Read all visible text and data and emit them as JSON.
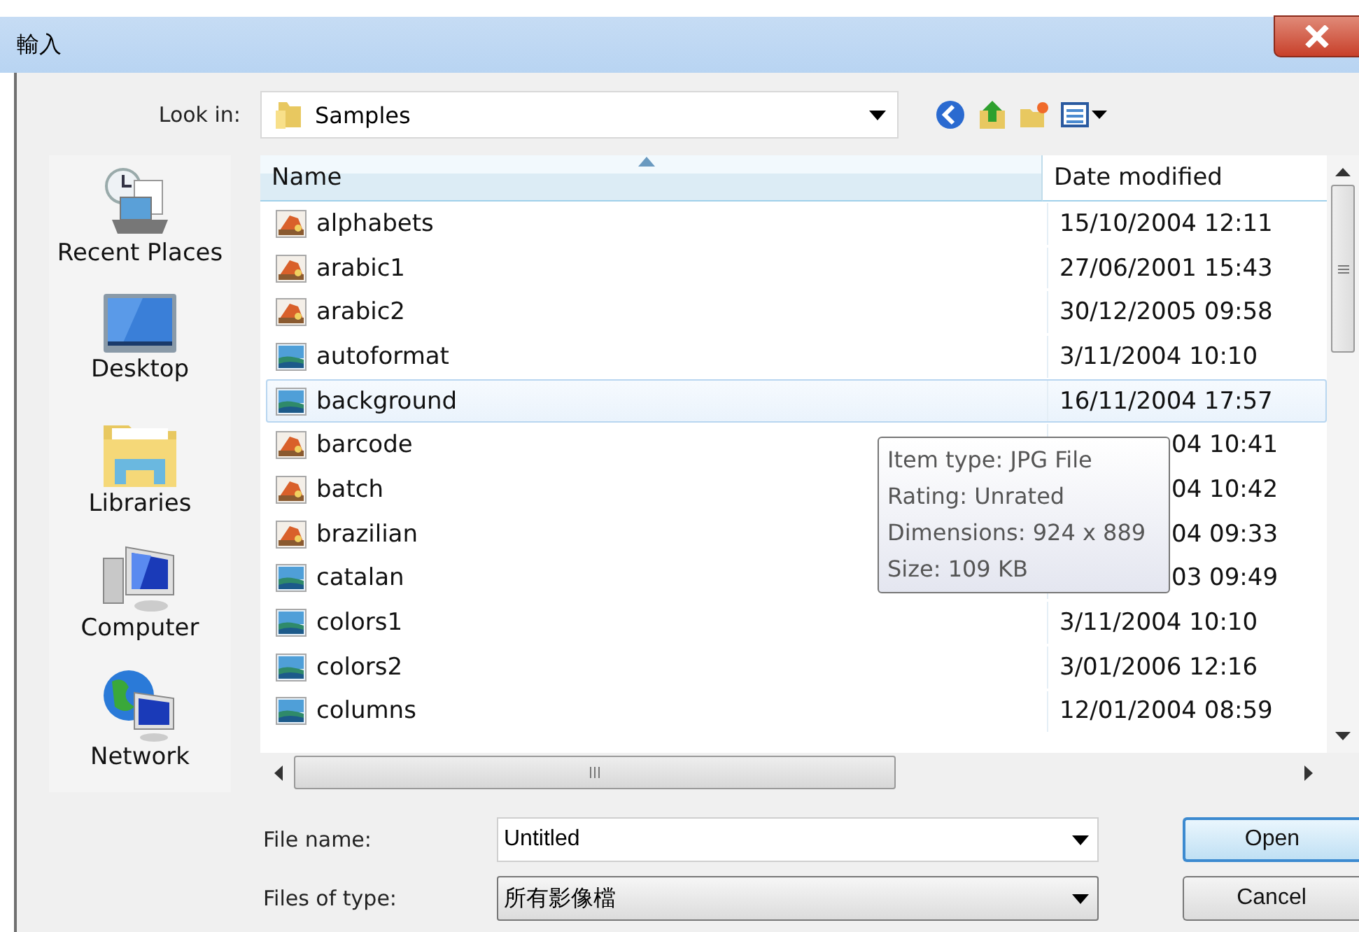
{
  "window": {
    "title": "輸入"
  },
  "look_in": {
    "label": "Look in:",
    "value": "Samples"
  },
  "sidebar": {
    "items": [
      {
        "label": "Recent Places",
        "kind": "recent"
      },
      {
        "label": "Desktop",
        "kind": "desktop"
      },
      {
        "label": "Libraries",
        "kind": "libraries"
      },
      {
        "label": "Computer",
        "kind": "computer"
      },
      {
        "label": "Network",
        "kind": "network"
      }
    ]
  },
  "table": {
    "columns": [
      {
        "label": "Name",
        "sorted": true
      },
      {
        "label": "Date modified",
        "sorted": false
      }
    ],
    "rows": [
      {
        "name": "alphabets",
        "date": "15/10/2004 12:11",
        "kind": "painting",
        "selected": false,
        "under_tooltip": false
      },
      {
        "name": "arabic1",
        "date": "27/06/2001 15:43",
        "kind": "painting",
        "selected": false,
        "under_tooltip": false
      },
      {
        "name": "arabic2",
        "date": "30/12/2005 09:58",
        "kind": "painting",
        "selected": false,
        "under_tooltip": false
      },
      {
        "name": "autoformat",
        "date": "3/11/2004 10:10",
        "kind": "landscape",
        "selected": false,
        "under_tooltip": false
      },
      {
        "name": "background",
        "date": "16/11/2004 17:57",
        "kind": "landscape",
        "selected": true,
        "under_tooltip": false
      },
      {
        "name": "barcode",
        "date": "04 10:41",
        "kind": "painting",
        "selected": false,
        "under_tooltip": true
      },
      {
        "name": "batch",
        "date": "04 10:42",
        "kind": "painting",
        "selected": false,
        "under_tooltip": true
      },
      {
        "name": "brazilian",
        "date": "04 09:33",
        "kind": "painting",
        "selected": false,
        "under_tooltip": true
      },
      {
        "name": "catalan",
        "date": "03 09:49",
        "kind": "landscape",
        "selected": false,
        "under_tooltip": true
      },
      {
        "name": "colors1",
        "date": "3/11/2004 10:10",
        "kind": "landscape",
        "selected": false,
        "under_tooltip": false
      },
      {
        "name": "colors2",
        "date": "3/01/2006 12:16",
        "kind": "landscape",
        "selected": false,
        "under_tooltip": false
      },
      {
        "name": "columns",
        "date": "12/01/2004 08:59",
        "kind": "landscape",
        "selected": false,
        "under_tooltip": false
      }
    ]
  },
  "tooltip": {
    "lines": [
      "Item type: JPG File",
      "Rating: Unrated",
      "Dimensions: 924 x 889",
      "Size: 109 KB"
    ]
  },
  "file_name": {
    "label": "File name:",
    "value": "Untitled"
  },
  "file_type": {
    "label": "Files of type:",
    "value": "所有影像檔"
  },
  "buttons": [
    {
      "label": "Open",
      "focused": true
    },
    {
      "label": "Cancel",
      "focused": false
    }
  ]
}
